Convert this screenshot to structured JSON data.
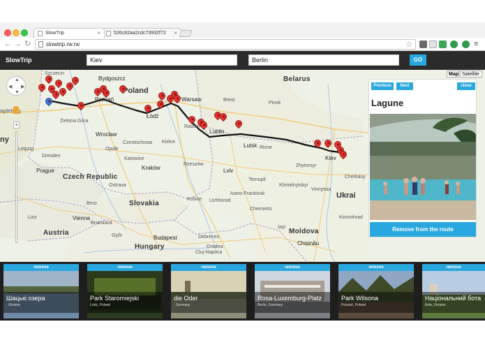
{
  "browser": {
    "tabs": [
      {
        "title": "SlowTrip",
        "active": true
      },
      {
        "title": "526c82aa2cdc73932f72",
        "active": false
      }
    ],
    "url": "slowtrip.rw.rw"
  },
  "app": {
    "brand": "SlowTrip",
    "from_city": "Kiev",
    "to_city": "Berlin",
    "go_label": "GO"
  },
  "map": {
    "type_buttons": [
      "Map",
      "Satellite"
    ],
    "labels": {
      "poland": "Poland",
      "belarus": "Belarus",
      "czech": "Czech Republic",
      "slovakia": "Slovakia",
      "austria": "Austria",
      "hungary": "Hungary",
      "moldova": "Moldova",
      "ukraine": "Ukrai",
      "germany": "ny",
      "bydgoszcz": "Bydgoszcz",
      "poznan": "Poznań",
      "warsaw": "Warsaw",
      "lodz": "Łódź",
      "wroclaw": "Wroclaw",
      "czestochowa": "Czestochowa",
      "kielce": "Kielce",
      "lublin": "Lublin",
      "lutsk": "Lutsk",
      "rivne": "Rivne",
      "kiev": "Kiev",
      "zhytomyr": "Zhytomyr",
      "lviv": "Lviv",
      "krakow": "Kraków",
      "katowice": "Katowice",
      "rzeszow": "Rzeszów",
      "ostrava": "Ostrava",
      "brno": "Brno",
      "prague": "Prague",
      "vienna": "Vienna",
      "bratislava": "Bratislava",
      "budapest": "Budapest",
      "kosice": "Košice",
      "chisinau": "Chișinău",
      "cluj": "Cluj-Napoca",
      "iasi": "Iași",
      "chernivtsi": "Chernivtsi",
      "ternopil": "Ternopil",
      "khmelnytskyi": "Khmelnytskyi",
      "vinnytsia": "Vinnytsia",
      "magdeburg": "agdeburg",
      "leipzig": "Leipzig",
      "dresden": "Dresden",
      "szczecin": "Szczecin",
      "zielona": "Zielona Góra",
      "opole": "Opole",
      "radom": "Radom",
      "brest": "Brest",
      "pinsk": "Pinsk",
      "kirovohrad": "Kirovohrad",
      "cherkasy": "Cherkasy",
      "linz": "Linz",
      "gyor": "Győr",
      "debrecen": "Debrecen",
      "oradea": "Oradea",
      "uzhhorod": "Uzhhorod",
      "ivano": "Ivano-Frankivsk"
    }
  },
  "panel": {
    "prev_label": "Previous",
    "next_label": "Next",
    "close_label": "close",
    "title": "Lagune",
    "remove_label": "Remove from the route"
  },
  "cards": [
    {
      "remove": "remove",
      "name": "Шацькі озера",
      "location": ", Ukraine"
    },
    {
      "remove": "remove",
      "name": "Park Staromiejski",
      "location": "Łódź, Poland"
    },
    {
      "remove": "remove",
      "name": "die Oder",
      "location": ", Germany"
    },
    {
      "remove": "remove",
      "name": "Rosa-Luxemburg-Platz",
      "location": "Berlin, Germany"
    },
    {
      "remove": "remove",
      "name": "Park Wilsona",
      "location": "Poznań, Poland"
    },
    {
      "remove": "remove",
      "name": "Національний бота",
      "location": "Київ, Ukraine"
    }
  ],
  "colors": {
    "accent": "#29a8e0",
    "appbar": "#2b2b2b",
    "pin": "#e8322f",
    "route": "#111111"
  }
}
